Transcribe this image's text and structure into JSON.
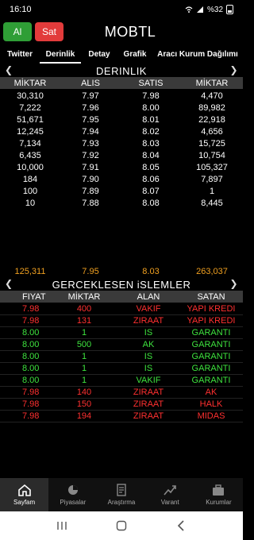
{
  "status": {
    "time": "16:10",
    "battery": "%32"
  },
  "header": {
    "buy_label": "Al",
    "sell_label": "Sat",
    "symbol": "MOBTL"
  },
  "tabs": [
    {
      "label": "Twitter",
      "active": false
    },
    {
      "label": "Derinlik",
      "active": true
    },
    {
      "label": "Detay",
      "active": false
    },
    {
      "label": "Grafik",
      "active": false
    },
    {
      "label": "Aracı Kurum Dağılımı",
      "active": false
    }
  ],
  "depth": {
    "title": "DERINLIK",
    "columns": [
      "MİKTAR",
      "ALIS",
      "SATIS",
      "MİKTAR"
    ],
    "rows": [
      [
        "30,310",
        "7.97",
        "7.98",
        "4,470"
      ],
      [
        "7,222",
        "7.96",
        "8.00",
        "89,982"
      ],
      [
        "51,671",
        "7.95",
        "8.01",
        "22,918"
      ],
      [
        "12,245",
        "7.94",
        "8.02",
        "4,656"
      ],
      [
        "7,134",
        "7.93",
        "8.03",
        "15,725"
      ],
      [
        "6,435",
        "7.92",
        "8.04",
        "10,754"
      ],
      [
        "10,000",
        "7.91",
        "8.05",
        "105,327"
      ],
      [
        "184",
        "7.90",
        "8.06",
        "7,897"
      ],
      [
        "100",
        "7.89",
        "8.07",
        "1"
      ],
      [
        "10",
        "7.88",
        "8.08",
        "8,445"
      ]
    ],
    "totals": [
      "125,311",
      "7.95",
      "8.03",
      "263,037"
    ]
  },
  "trades": {
    "title": "GERCEKLESEN iSLEMLER",
    "columns": [
      "FIYAT",
      "MİKTAR",
      "ALAN",
      "SATAN"
    ],
    "rows": [
      {
        "price": "7.98",
        "qty": "400",
        "buyer": "VAKIF",
        "seller": "YAPI KREDI",
        "color": "red"
      },
      {
        "price": "7.98",
        "qty": "131",
        "buyer": "ZIRAAT",
        "seller": "YAPI KREDI",
        "color": "red"
      },
      {
        "price": "8.00",
        "qty": "1",
        "buyer": "IS",
        "seller": "GARANTI",
        "color": "green"
      },
      {
        "price": "8.00",
        "qty": "500",
        "buyer": "AK",
        "seller": "GARANTI",
        "color": "green"
      },
      {
        "price": "8.00",
        "qty": "1",
        "buyer": "IS",
        "seller": "GARANTI",
        "color": "green"
      },
      {
        "price": "8.00",
        "qty": "1",
        "buyer": "IS",
        "seller": "GARANTI",
        "color": "green"
      },
      {
        "price": "8.00",
        "qty": "1",
        "buyer": "VAKIF",
        "seller": "GARANTI",
        "color": "green"
      },
      {
        "price": "7.98",
        "qty": "140",
        "buyer": "ZIRAAT",
        "seller": "AK",
        "color": "red"
      },
      {
        "price": "7.98",
        "qty": "150",
        "buyer": "ZIRAAT",
        "seller": "HALK",
        "color": "red"
      },
      {
        "price": "7.98",
        "qty": "194",
        "buyer": "ZIRAAT",
        "seller": "MIDAS",
        "color": "red"
      }
    ]
  },
  "bottom_nav": [
    {
      "label": "Sayfam",
      "icon": "home-icon",
      "active": true
    },
    {
      "label": "Piyasalar",
      "icon": "pie-chart-icon",
      "active": false
    },
    {
      "label": "Araştırma",
      "icon": "document-icon",
      "active": false
    },
    {
      "label": "Varant",
      "icon": "trend-icon",
      "active": false
    },
    {
      "label": "Kurumlar",
      "icon": "briefcase-icon",
      "active": false
    }
  ],
  "colors": {
    "buy": "#2f9e36",
    "sell": "#e23b3b",
    "total": "#f0a020",
    "up": "#3ee33e",
    "down": "#ff3030"
  }
}
